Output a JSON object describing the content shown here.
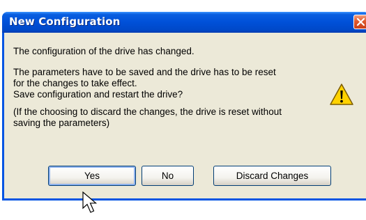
{
  "dialog": {
    "title": "New Configuration",
    "close_icon": "close-icon",
    "message_line1": "The configuration of the drive has changed.",
    "message_line2": "The parameters have to be saved and the drive has to be reset",
    "message_line3": "for the changes to take effect.",
    "message_line4": "Save configuration and restart the drive?",
    "message_line5": "(If the choosing to discard the changes, the drive is reset without",
    "message_line6": "saving the parameters)",
    "icon": "warning-icon",
    "buttons": {
      "yes_label": "Yes",
      "no_label": "No",
      "discard_label": "Discard Changes"
    }
  },
  "pointer": "mouse-cursor-icon",
  "colors": {
    "titlebar": "#0050d8",
    "dialog_background": "#ece9d8",
    "close_button": "#e0582c",
    "warning_yellow": "#ffd200"
  }
}
